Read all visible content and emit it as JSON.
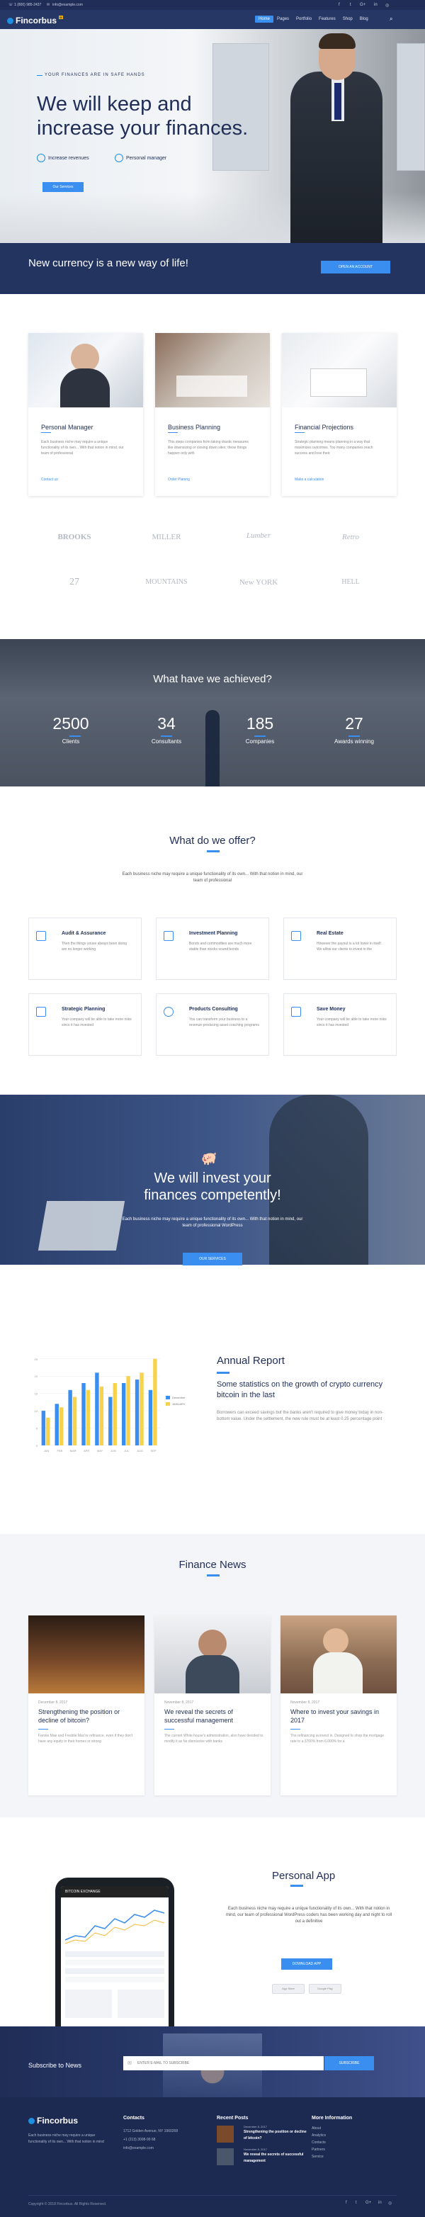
{
  "topbar": {
    "phone": "1 (800) 985-2437",
    "email": "info@example.com",
    "social_icons": [
      "facebook-icon",
      "twitter-icon",
      "google-plus-icon",
      "linkedin-icon",
      "instagram-icon"
    ]
  },
  "header": {
    "logo": "Fincorbus",
    "logo_badge": "W",
    "nav": [
      "Home",
      "Pages",
      "Portfolio",
      "Features",
      "Shop",
      "Blog"
    ],
    "active_nav": "Home"
  },
  "hero": {
    "subtitle": "YOUR FINANCES ARE IN SAFE HANDS",
    "title_line1": "We will keep and",
    "title_line2": "increase your finances.",
    "feature1": "Increase revenues",
    "feature2": "Personal manager",
    "button": "Our Services"
  },
  "banner": {
    "text": "New currency is a new way of life!",
    "button": "OPEN AN ACCOUNT"
  },
  "services": [
    {
      "title": "Personal Manager",
      "text": "Each business niche may require a unique functionality of its own... With that notion in mind, our team of professional",
      "link": "Contact us"
    },
    {
      "title": "Business Planning",
      "text": "This steps companies from taking drastic measures like downsizing or closing down sites; these things happen only with",
      "link": "Order Planing"
    },
    {
      "title": "Financial Projections",
      "text": "Strategic planning means planning in a way that maximizes outcomes. Too many companies reach success and lose their.",
      "link": "Make a calculation"
    }
  ],
  "brands": [
    "BROOKS",
    "MILLER",
    "Lumber",
    "Retro",
    "27",
    "MOUNTAINS",
    "New YORK",
    "HELL"
  ],
  "stats": {
    "title": "What have we achieved?",
    "items": [
      {
        "num": "2500",
        "label": "Clients"
      },
      {
        "num": "34",
        "label": "Consultants"
      },
      {
        "num": "185",
        "label": "Companies"
      },
      {
        "num": "27",
        "label": "Awards winning"
      }
    ]
  },
  "offer": {
    "title": "What do we offer?",
    "desc": "Each business niche may require a unique functionality of its own... With that notion in mind, our team of professional",
    "items": [
      {
        "title": "Audit & Assurance",
        "text": "Then the things youve always been doing are no longer working"
      },
      {
        "title": "Investment Planning",
        "text": "Bonds and commodities are much more stable than stocks sound bonds"
      },
      {
        "title": "Real Estate",
        "text": "However the payout is a lot lower in itself. We allow our clients to invest in the"
      },
      {
        "title": "Strategic Planning",
        "text": "Your company will be able to take more risks since it has invested"
      },
      {
        "title": "Products Consulting",
        "text": "You can transform your business to a revenue-producing asset coaching programs"
      },
      {
        "title": "Save Money",
        "text": "Your company will be able to take more risks since it has invested"
      }
    ]
  },
  "invest": {
    "title_line1": "We will invest your",
    "title_line2": "finances competently!",
    "desc": "Each business niche may require a unique functionality of its own... With that notion in mind, our team of professional WordPress",
    "button": "OUR SERVICES"
  },
  "report": {
    "title": "Annual Report",
    "subtitle": "Some statistics on the growth of crypto currency bitcoin in the last",
    "text": "Borrowers can exceed savings but the banks aren't required to give money today in non-bottom value. Under the settlement, the new rule must be at least 0.25 percentage point"
  },
  "chart_data": {
    "type": "bar",
    "categories": [
      "JAN",
      "FEB",
      "MAR",
      "APR",
      "MAY",
      "JUN",
      "JUL",
      "AUG",
      "SEP"
    ],
    "series": [
      {
        "name": "December",
        "color": "#3a8ef0",
        "values": [
          10,
          12,
          16,
          18,
          21,
          14,
          18,
          19,
          16
        ]
      },
      {
        "name": "JANUARY",
        "color": "#f7d24d",
        "values": [
          8,
          11,
          14,
          16,
          17,
          18,
          20,
          21,
          25
        ]
      }
    ],
    "yticks": [
      0,
      5,
      10,
      15,
      20,
      25
    ],
    "ylim": [
      0,
      27
    ],
    "legend": "right"
  },
  "news": {
    "title": "Finance News",
    "items": [
      {
        "date": "December 8, 2017",
        "title": "Strengthening the position or decline of bitcoin?",
        "text": "Fannie Mae and Freddie Mac're refinance, even if they don't have any equity in their homes or strong"
      },
      {
        "date": "November 8, 2017",
        "title": "We reveal the secrets of successful management",
        "text": "The current White house's administration, also have decided to modify it as far dismissive with banks"
      },
      {
        "date": "November 8, 2017",
        "title": "Where to invest your savings in 2017",
        "text": "The refinancing ia invest in. Designed to shop the mortgage rate to a 3700% from 6.000% for a"
      }
    ]
  },
  "app": {
    "title": "Personal App",
    "desc": "Each business niche may require a unique functionality of its own... With that notion in mind, our team of professional WordPress coders has been working day and night to roll out a definitive",
    "button": "DOWNLOAD APP",
    "store1": "App Store",
    "store2": "Google Play",
    "phone_header": "BITCOIN EXCHANGE"
  },
  "subscribe": {
    "title": "Subscribe to News",
    "placeholder": "ENTER E-MAIL TO SUBSCRIBE",
    "button": "SUBSCRIBE"
  },
  "footer": {
    "logo": "Fincorbus",
    "about": "Each business niche may require a unique functionality of its own... With that notion in mind",
    "contacts_title": "Contacts",
    "contacts": [
      "1712 Golden Avenue, NY 1960268",
      "+1 (213) 3008-99 68",
      "info@example.com"
    ],
    "posts_title": "Recent Posts",
    "posts": [
      {
        "date": "December 8, 2017",
        "title": "Strengthening the position or decline of bitcoin?"
      },
      {
        "date": "November 8, 2017",
        "title": "We reveal the secrets of successful management"
      }
    ],
    "more_title": "More Information",
    "more": [
      "About",
      "Analytics",
      "Contacts",
      "Partners",
      "Service"
    ],
    "copyright": "Copyright © 2018 Fincorbus. All Rights Reserved."
  }
}
